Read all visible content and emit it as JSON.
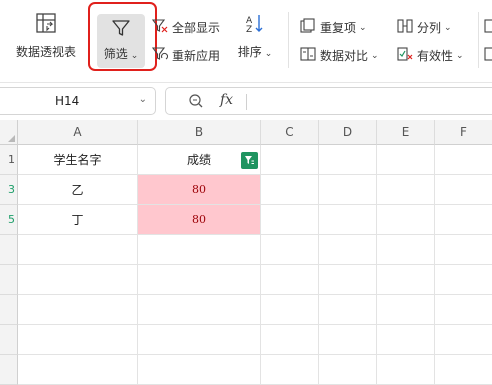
{
  "ribbon": {
    "pivot_label": "数据透视表",
    "filter_label": "筛选",
    "show_all_label": "全部显示",
    "reapply_label": "重新应用",
    "sort_label": "排序",
    "duplicates_label": "重复项",
    "compare_label": "数据对比",
    "split_label": "分列",
    "validity_label": "有效性"
  },
  "formula_bar": {
    "name_box": "H14",
    "fx_label": "fx",
    "formula": ""
  },
  "sheet": {
    "columns": [
      "A",
      "B",
      "C",
      "D",
      "E",
      "F"
    ],
    "rows": [
      {
        "num": "1",
        "filtered": false,
        "a": "学生名字",
        "b": "成绩",
        "b_pink": false
      },
      {
        "num": "3",
        "filtered": true,
        "a": "乙",
        "b": "80",
        "b_pink": true
      },
      {
        "num": "5",
        "filtered": true,
        "a": "丁",
        "b": "80",
        "b_pink": true
      },
      {
        "num": "",
        "filtered": false,
        "a": "",
        "b": "",
        "b_pink": false
      },
      {
        "num": "",
        "filtered": false,
        "a": "",
        "b": "",
        "b_pink": false
      },
      {
        "num": "",
        "filtered": false,
        "a": "",
        "b": "",
        "b_pink": false
      },
      {
        "num": "",
        "filtered": false,
        "a": "",
        "b": "",
        "b_pink": false
      },
      {
        "num": "",
        "filtered": false,
        "a": "",
        "b": "",
        "b_pink": false
      }
    ]
  },
  "colors": {
    "highlight": "#e0201c",
    "filter_indicator": "#1f9460",
    "bad_fill": "#ffc7ce",
    "bad_text": "#9c0006",
    "filtered_row_num": "#1e9f6a"
  }
}
